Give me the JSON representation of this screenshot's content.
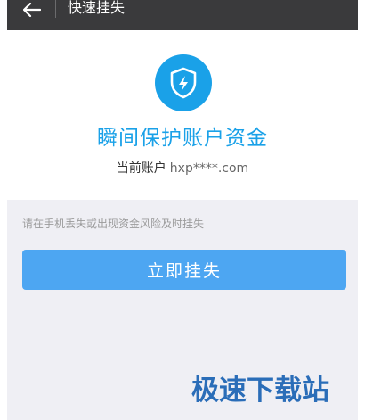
{
  "header": {
    "back_icon": "arrow-left-icon",
    "title": "快速挂失"
  },
  "card": {
    "icon": "shield-lightning-icon",
    "headline": "瞬间保护账户资金",
    "account_label": "当前账户",
    "account_value": "hxp****.com"
  },
  "hint": "请在手机丢失或出现资金风险及时挂失",
  "action_button": {
    "label": "立即挂失"
  },
  "watermark": "极速下载站",
  "colors": {
    "accent": "#1aa1e8",
    "button": "#4da6f2",
    "topbar": "#3a3a3c",
    "background": "#efeff4"
  }
}
